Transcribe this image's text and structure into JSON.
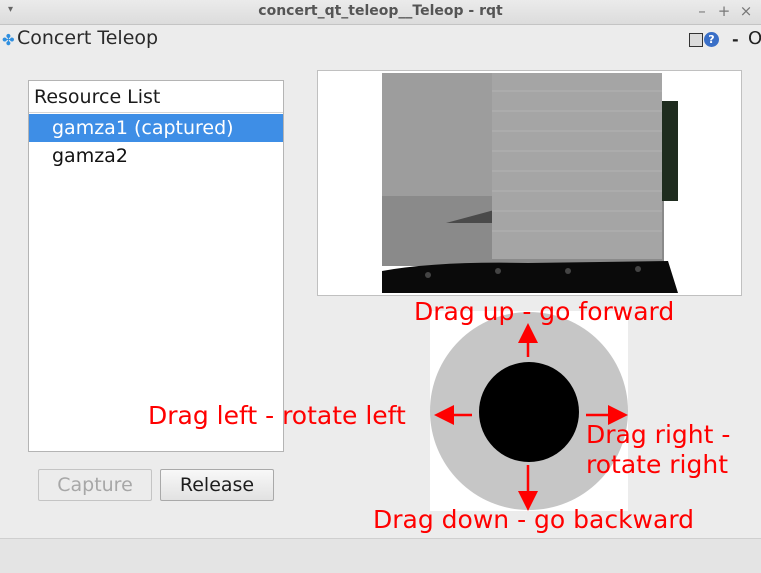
{
  "window": {
    "title": "concert_qt_teleop__Teleop - rqt",
    "menu_glyph": "▾",
    "minimize_glyph": "–",
    "maximize_glyph": "+",
    "close_glyph": "×"
  },
  "plugin": {
    "icon_glyph": "✤",
    "title": "Concert Teleop",
    "help_glyph": "?",
    "close_glyph": "-",
    "reload_glyph": "O"
  },
  "resource_list": {
    "header": "Resource List",
    "items": [
      {
        "label": "gamza1 (captured)",
        "selected": true
      },
      {
        "label": "gamza2",
        "selected": false
      }
    ]
  },
  "buttons": {
    "capture": "Capture",
    "release": "Release"
  },
  "camera": {
    "label": ""
  },
  "joystick": {
    "forward": "Drag up - go forward",
    "left": "Drag left - rotate left",
    "right_line1": "Drag right -",
    "right_line2": "rotate right",
    "backward": "Drag down - go backward"
  },
  "colors": {
    "selection": "#3e8ee6",
    "hint_text": "#ff0000",
    "joystick_ring": "#c6c6c6",
    "joystick_knob": "#000000"
  }
}
